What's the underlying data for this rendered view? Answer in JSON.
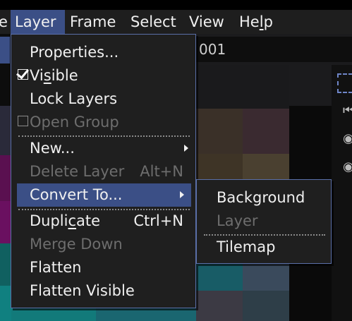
{
  "menubar": {
    "items": [
      {
        "label": "e"
      },
      {
        "label": "Layer",
        "active": true
      },
      {
        "label": "Frame"
      },
      {
        "label": "Select"
      },
      {
        "label": "View"
      },
      {
        "label_parts": [
          "He",
          "l",
          "p"
        ]
      }
    ]
  },
  "background": {
    "frame_text": "001"
  },
  "layer_menu": {
    "items": [
      {
        "label": "Properties..."
      },
      {
        "label_parts": [
          "Vi",
          "s",
          "ible"
        ],
        "checked": true
      },
      {
        "label": "Lock Layers"
      },
      {
        "label": "Open Group",
        "checked": false,
        "disabled": true
      },
      {
        "label": "New...",
        "submenu": true
      },
      {
        "label": "Delete Layer",
        "accel": "Alt+N",
        "disabled": true
      },
      {
        "label": "Convert To...",
        "submenu": true,
        "active": true
      },
      {
        "label_parts": [
          "Dupli",
          "c",
          "ate"
        ],
        "accel": "Ctrl+N"
      },
      {
        "label": "Merge Down",
        "disabled": true
      },
      {
        "label": "Flatten"
      },
      {
        "label": "Flatten Visible"
      }
    ]
  },
  "convert_submenu": {
    "items": [
      {
        "label": "Background"
      },
      {
        "label": "Layer",
        "disabled": true
      },
      {
        "label": "Tilemap"
      }
    ]
  },
  "colors": {
    "menu_bg": "#1f1f1f",
    "highlight": "#3b4f86",
    "border": "#5a6fa8",
    "disabled_text": "#6d6d6d"
  }
}
